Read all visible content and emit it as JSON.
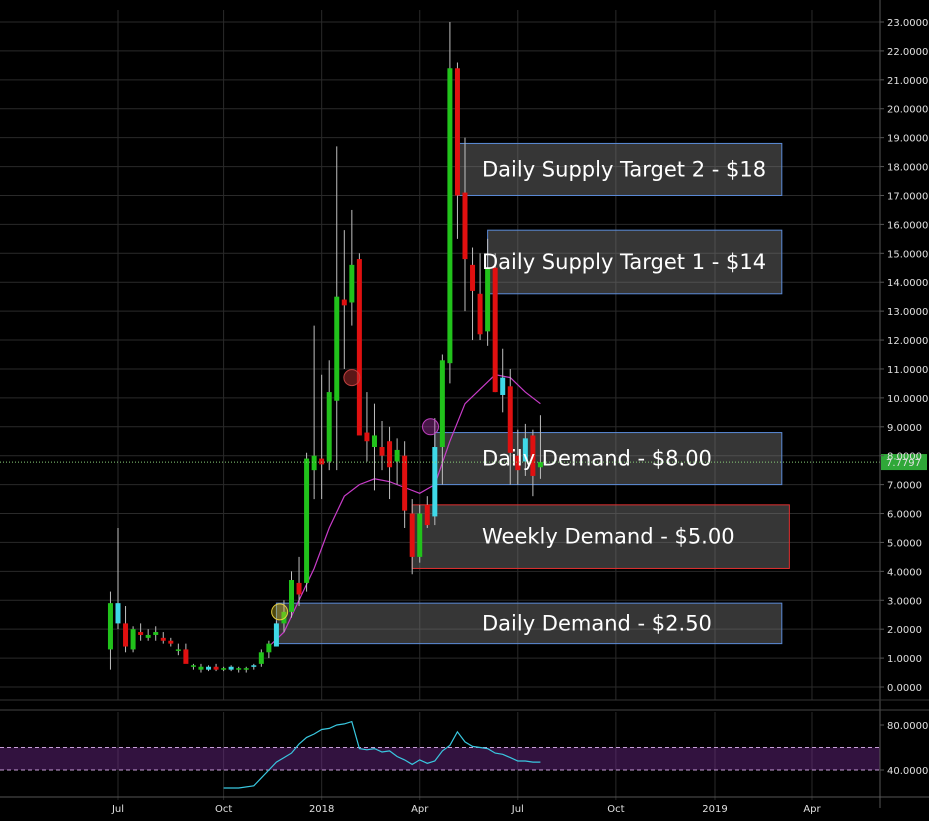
{
  "chart_data": [
    {
      "type": "candlestick",
      "scale": "linear",
      "ylim": [
        -0.6,
        23.3
      ],
      "grid": true,
      "y_ticks": [
        "0.0000",
        "1.0000",
        "2.0000",
        "3.0000",
        "4.0000",
        "5.0000",
        "6.0000",
        "7.0000",
        "8.0000",
        "9.0000",
        "10.0000",
        "11.0000",
        "12.0000",
        "13.0000",
        "14.0000",
        "15.0000",
        "16.0000",
        "17.0000",
        "18.0000",
        "19.0000",
        "20.0000",
        "21.0000",
        "22.0000",
        "23.0000"
      ],
      "x_ticks": [
        "Jul",
        "Oct",
        "2018",
        "Apr",
        "Jul",
        "Oct",
        "2019",
        "Apr"
      ],
      "last_price": "7.7797",
      "last_price_value": 7.7797,
      "colors": {
        "up": "#21c21b",
        "down": "#e01010",
        "up_alt": "#3fd9e8",
        "ma": "#c83cc8",
        "grid": "#2a2a2a",
        "axis": "#555555"
      },
      "candles": [
        {
          "date": "2017-06-19",
          "o": 1.3,
          "h": 3.3,
          "l": 0.6,
          "c": 2.9
        },
        {
          "date": "2017-06-26",
          "o": 2.2,
          "h": 5.5,
          "l": 2.0,
          "c": 2.9
        },
        {
          "date": "2017-07-03",
          "o": 2.2,
          "h": 2.8,
          "l": 1.2,
          "c": 1.4
        },
        {
          "date": "2017-07-10",
          "o": 1.3,
          "h": 2.1,
          "l": 1.2,
          "c": 2.0
        },
        {
          "date": "2017-07-17",
          "o": 1.9,
          "h": 2.2,
          "l": 1.6,
          "c": 1.8
        },
        {
          "date": "2017-07-24",
          "o": 1.7,
          "h": 2.0,
          "l": 1.6,
          "c": 1.8
        },
        {
          "date": "2017-07-31",
          "o": 1.8,
          "h": 2.1,
          "l": 1.6,
          "c": 1.9
        },
        {
          "date": "2017-08-07",
          "o": 1.7,
          "h": 1.9,
          "l": 1.5,
          "c": 1.6
        },
        {
          "date": "2017-08-14",
          "o": 1.6,
          "h": 1.7,
          "l": 1.4,
          "c": 1.5
        },
        {
          "date": "2017-08-21",
          "o": 1.3,
          "h": 1.5,
          "l": 1.1,
          "c": 1.3
        },
        {
          "date": "2017-08-28",
          "o": 1.3,
          "h": 1.5,
          "l": 0.9,
          "c": 0.8
        },
        {
          "date": "2017-09-04",
          "o": 0.7,
          "h": 0.8,
          "l": 0.6,
          "c": 0.75
        },
        {
          "date": "2017-09-11",
          "o": 0.6,
          "h": 0.8,
          "l": 0.5,
          "c": 0.7
        },
        {
          "date": "2017-09-18",
          "o": 0.6,
          "h": 0.75,
          "l": 0.55,
          "c": 0.7
        },
        {
          "date": "2017-09-25",
          "o": 0.7,
          "h": 0.8,
          "l": 0.55,
          "c": 0.6
        },
        {
          "date": "2017-10-02",
          "o": 0.6,
          "h": 0.7,
          "l": 0.55,
          "c": 0.65
        },
        {
          "date": "2017-10-09",
          "o": 0.6,
          "h": 0.75,
          "l": 0.55,
          "c": 0.7
        },
        {
          "date": "2017-10-16",
          "o": 0.6,
          "h": 0.7,
          "l": 0.5,
          "c": 0.65
        },
        {
          "date": "2017-10-23",
          "o": 0.6,
          "h": 0.7,
          "l": 0.5,
          "c": 0.65
        },
        {
          "date": "2017-10-30",
          "o": 0.7,
          "h": 0.8,
          "l": 0.6,
          "c": 0.75
        },
        {
          "date": "2017-11-06",
          "o": 0.8,
          "h": 1.3,
          "l": 0.7,
          "c": 1.2
        },
        {
          "date": "2017-11-13",
          "o": 1.2,
          "h": 1.6,
          "l": 1.0,
          "c": 1.5
        },
        {
          "date": "2017-11-20",
          "o": 1.4,
          "h": 2.3,
          "l": 1.4,
          "c": 2.2
        },
        {
          "date": "2017-11-27",
          "o": 2.2,
          "h": 3.0,
          "l": 1.9,
          "c": 2.6
        },
        {
          "date": "2017-12-04",
          "o": 2.6,
          "h": 4.0,
          "l": 2.4,
          "c": 3.7
        },
        {
          "date": "2017-12-11",
          "o": 3.6,
          "h": 4.5,
          "l": 2.8,
          "c": 3.2
        },
        {
          "date": "2017-12-18",
          "o": 3.6,
          "h": 8.1,
          "l": 3.3,
          "c": 7.9
        },
        {
          "date": "2017-12-25",
          "o": 7.5,
          "h": 12.5,
          "l": 6.5,
          "c": 8.0
        },
        {
          "date": "2018-01-01",
          "o": 7.9,
          "h": 10.8,
          "l": 6.5,
          "c": 7.7
        },
        {
          "date": "2018-01-08",
          "o": 7.8,
          "h": 11.3,
          "l": 7.5,
          "c": 10.2
        },
        {
          "date": "2018-01-15",
          "o": 9.9,
          "h": 18.7,
          "l": 7.5,
          "c": 13.5
        },
        {
          "date": "2018-01-22",
          "o": 13.4,
          "h": 15.8,
          "l": 11.0,
          "c": 13.2
        },
        {
          "date": "2018-01-29",
          "o": 13.3,
          "h": 16.5,
          "l": 12.5,
          "c": 14.6
        },
        {
          "date": "2018-02-05",
          "o": 14.8,
          "h": 15.0,
          "l": 10.2,
          "c": 8.7
        },
        {
          "date": "2018-02-12",
          "o": 8.8,
          "h": 10.2,
          "l": 7.8,
          "c": 8.5
        },
        {
          "date": "2018-02-19",
          "o": 8.3,
          "h": 9.8,
          "l": 6.8,
          "c": 8.7
        },
        {
          "date": "2018-02-26",
          "o": 8.3,
          "h": 9.2,
          "l": 7.5,
          "c": 8.0
        },
        {
          "date": "2018-03-05",
          "o": 8.5,
          "h": 9.0,
          "l": 6.5,
          "c": 7.6
        },
        {
          "date": "2018-03-12",
          "o": 7.8,
          "h": 8.6,
          "l": 7.0,
          "c": 8.2
        },
        {
          "date": "2018-03-19",
          "o": 8.0,
          "h": 8.5,
          "l": 5.5,
          "c": 6.1
        },
        {
          "date": "2018-03-26",
          "o": 6.0,
          "h": 6.5,
          "l": 3.9,
          "c": 4.5
        },
        {
          "date": "2018-04-02",
          "o": 4.5,
          "h": 6.3,
          "l": 4.3,
          "c": 6.0
        },
        {
          "date": "2018-04-09",
          "o": 6.3,
          "h": 6.6,
          "l": 5.5,
          "c": 5.6
        },
        {
          "date": "2018-04-16",
          "o": 5.9,
          "h": 9.3,
          "l": 5.6,
          "c": 8.3
        },
        {
          "date": "2018-04-23",
          "o": 8.3,
          "h": 11.5,
          "l": 7.0,
          "c": 11.3
        },
        {
          "date": "2018-04-30",
          "o": 11.2,
          "h": 23.0,
          "l": 10.5,
          "c": 21.4
        },
        {
          "date": "2018-05-07",
          "o": 21.4,
          "h": 21.6,
          "l": 15.5,
          "c": 17.0
        },
        {
          "date": "2018-05-14",
          "o": 17.1,
          "h": 19.0,
          "l": 13.0,
          "c": 14.8
        },
        {
          "date": "2018-05-21",
          "o": 14.6,
          "h": 15.2,
          "l": 12.0,
          "c": 13.7
        },
        {
          "date": "2018-05-28",
          "o": 13.6,
          "h": 15.0,
          "l": 12.0,
          "c": 12.2
        },
        {
          "date": "2018-06-04",
          "o": 12.3,
          "h": 15.5,
          "l": 11.8,
          "c": 14.5
        },
        {
          "date": "2018-06-11",
          "o": 14.5,
          "h": 15.0,
          "l": 10.2,
          "c": 10.2
        },
        {
          "date": "2018-06-18",
          "o": 10.1,
          "h": 11.7,
          "l": 9.5,
          "c": 10.7
        },
        {
          "date": "2018-06-25",
          "o": 10.4,
          "h": 11.0,
          "l": 7.0,
          "c": 8.1
        },
        {
          "date": "2018-07-02",
          "o": 8.0,
          "h": 8.9,
          "l": 7.0,
          "c": 7.5
        },
        {
          "date": "2018-07-09",
          "o": 7.8,
          "h": 9.1,
          "l": 7.3,
          "c": 8.6
        },
        {
          "date": "2018-07-16",
          "o": 8.7,
          "h": 8.9,
          "l": 6.6,
          "c": 7.3
        },
        {
          "date": "2018-07-23",
          "o": 7.6,
          "h": 9.4,
          "l": 7.2,
          "c": 7.78
        }
      ],
      "moving_average": {
        "dates": [
          "2017-11-13",
          "2017-11-27",
          "2017-12-11",
          "2017-12-25",
          "2018-01-08",
          "2018-01-22",
          "2018-02-05",
          "2018-02-19",
          "2018-03-05",
          "2018-03-19",
          "2018-04-02",
          "2018-04-16",
          "2018-04-30",
          "2018-05-14",
          "2018-05-28",
          "2018-06-11",
          "2018-06-25",
          "2018-07-09",
          "2018-07-23"
        ],
        "values": [
          1.4,
          1.9,
          3.0,
          4.1,
          5.5,
          6.6,
          7.0,
          7.2,
          7.1,
          6.9,
          6.7,
          7.0,
          8.5,
          9.8,
          10.3,
          10.8,
          10.7,
          10.2,
          9.8
        ]
      },
      "annotations": [
        {
          "label": "Daily Supply Target 2 - $18",
          "x0": "2018-05-07",
          "x1": "2019-03-04",
          "y0": 17.0,
          "y1": 18.8,
          "color": "#5b8bd8"
        },
        {
          "label": "Daily Supply Target 1 - $14",
          "x0": "2018-06-04",
          "x1": "2019-03-04",
          "y0": 13.6,
          "y1": 15.8,
          "color": "#5b8bd8"
        },
        {
          "label": "Daily Demand - $8.00",
          "x0": "2018-04-16",
          "x1": "2019-03-04",
          "y0": 7.0,
          "y1": 8.8,
          "color": "#5b8bd8"
        },
        {
          "label": "Weekly Demand - $5.00",
          "x0": "2018-03-26",
          "x1": "2019-03-11",
          "y0": 4.1,
          "y1": 6.3,
          "color": "#e03030"
        },
        {
          "label": "Daily Demand - $2.50",
          "x0": "2017-11-20",
          "x1": "2019-03-04",
          "y0": 1.5,
          "y1": 2.9,
          "color": "#5b8bd8"
        }
      ],
      "markers": [
        {
          "date": "2017-11-23",
          "y": 2.6,
          "fill": "rgba(220,200,40,0.35)",
          "stroke": "#e8d040"
        },
        {
          "date": "2018-01-29",
          "y": 10.7,
          "fill": "rgba(200,50,50,0.45)",
          "stroke": "#c04040"
        },
        {
          "date": "2018-04-12",
          "y": 9.0,
          "fill": "rgba(200,60,200,0.35)",
          "stroke": "#c040c0"
        }
      ]
    },
    {
      "type": "line",
      "name": "",
      "ylim": [
        20,
        90
      ],
      "y_ticks": [
        "40.0000",
        "80.0000"
      ],
      "band": [
        40,
        60
      ],
      "color": "#39c8e0",
      "dates": [
        "2017-10-02",
        "2017-10-16",
        "2017-10-30",
        "2017-11-06",
        "2017-11-13",
        "2017-11-20",
        "2017-11-27",
        "2017-12-04",
        "2017-12-11",
        "2017-12-18",
        "2017-12-25",
        "2018-01-01",
        "2018-01-08",
        "2018-01-15",
        "2018-01-22",
        "2018-01-29",
        "2018-02-05",
        "2018-02-12",
        "2018-02-19",
        "2018-02-26",
        "2018-03-05",
        "2018-03-12",
        "2018-03-19",
        "2018-03-26",
        "2018-04-02",
        "2018-04-09",
        "2018-04-16",
        "2018-04-23",
        "2018-04-30",
        "2018-05-07",
        "2018-05-14",
        "2018-05-21",
        "2018-05-28",
        "2018-06-04",
        "2018-06-11",
        "2018-06-18",
        "2018-06-25",
        "2018-07-02",
        "2018-07-09",
        "2018-07-16",
        "2018-07-23"
      ],
      "values": [
        24,
        24,
        26,
        33,
        40,
        47,
        51,
        55,
        63,
        69,
        72,
        76,
        77,
        80,
        81,
        83,
        59,
        58,
        59,
        56,
        57,
        52,
        49,
        45,
        49,
        46,
        48,
        57,
        62,
        74,
        65,
        61,
        60,
        59,
        55,
        54,
        51,
        48,
        48,
        47,
        47
      ]
    }
  ]
}
